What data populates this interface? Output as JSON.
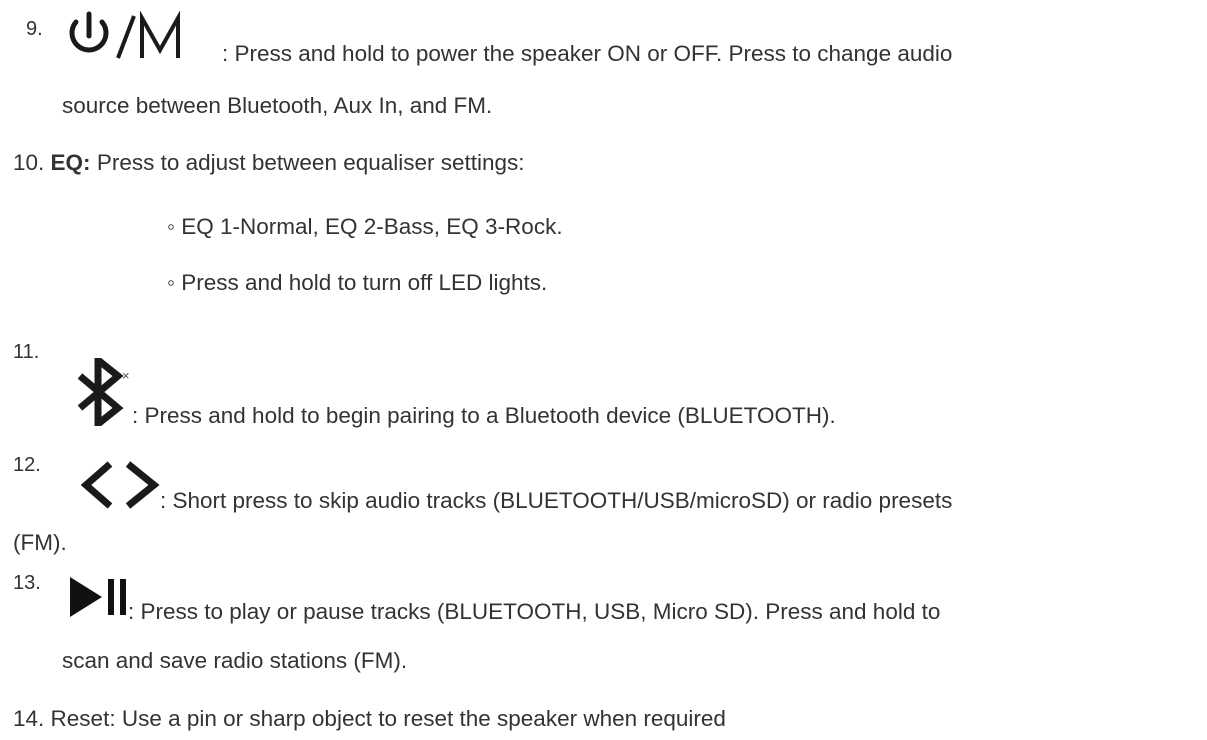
{
  "items": [
    {
      "number": "9.",
      "icon": "power-mode-icon",
      "line1": ": Press and hold to power the speaker ON or OFF. Press to change audio",
      "line2": "source between Bluetooth, Aux In, and FM."
    },
    {
      "number": "10.",
      "label": "EQ:",
      "text": " Press to adjust between equaliser settings:",
      "sub_items": [
        "◦ EQ 1-Normal, EQ 2-Bass, EQ 3-Rock.",
        "◦ Press and hold to turn off LED lights."
      ]
    },
    {
      "number": "11.",
      "icon": "bluetooth-icon",
      "line1": ": Press and hold to begin pairing to a Bluetooth device (BLUETOOTH)."
    },
    {
      "number": "12.",
      "icon": "prev-next-icon",
      "line1": ": Short press to skip audio tracks (BLUETOOTH/USB/microSD) or radio presets",
      "line2": "(FM)."
    },
    {
      "number": "13.",
      "icon": "play-pause-icon",
      "line1": ": Press to play or pause tracks (BLUETOOTH, USB, Micro SD). Press and hold to",
      "line2": "scan and save radio stations (FM)."
    },
    {
      "number": "14.",
      "text": "Reset: Use a pin or sharp object to reset the speaker when required"
    }
  ]
}
